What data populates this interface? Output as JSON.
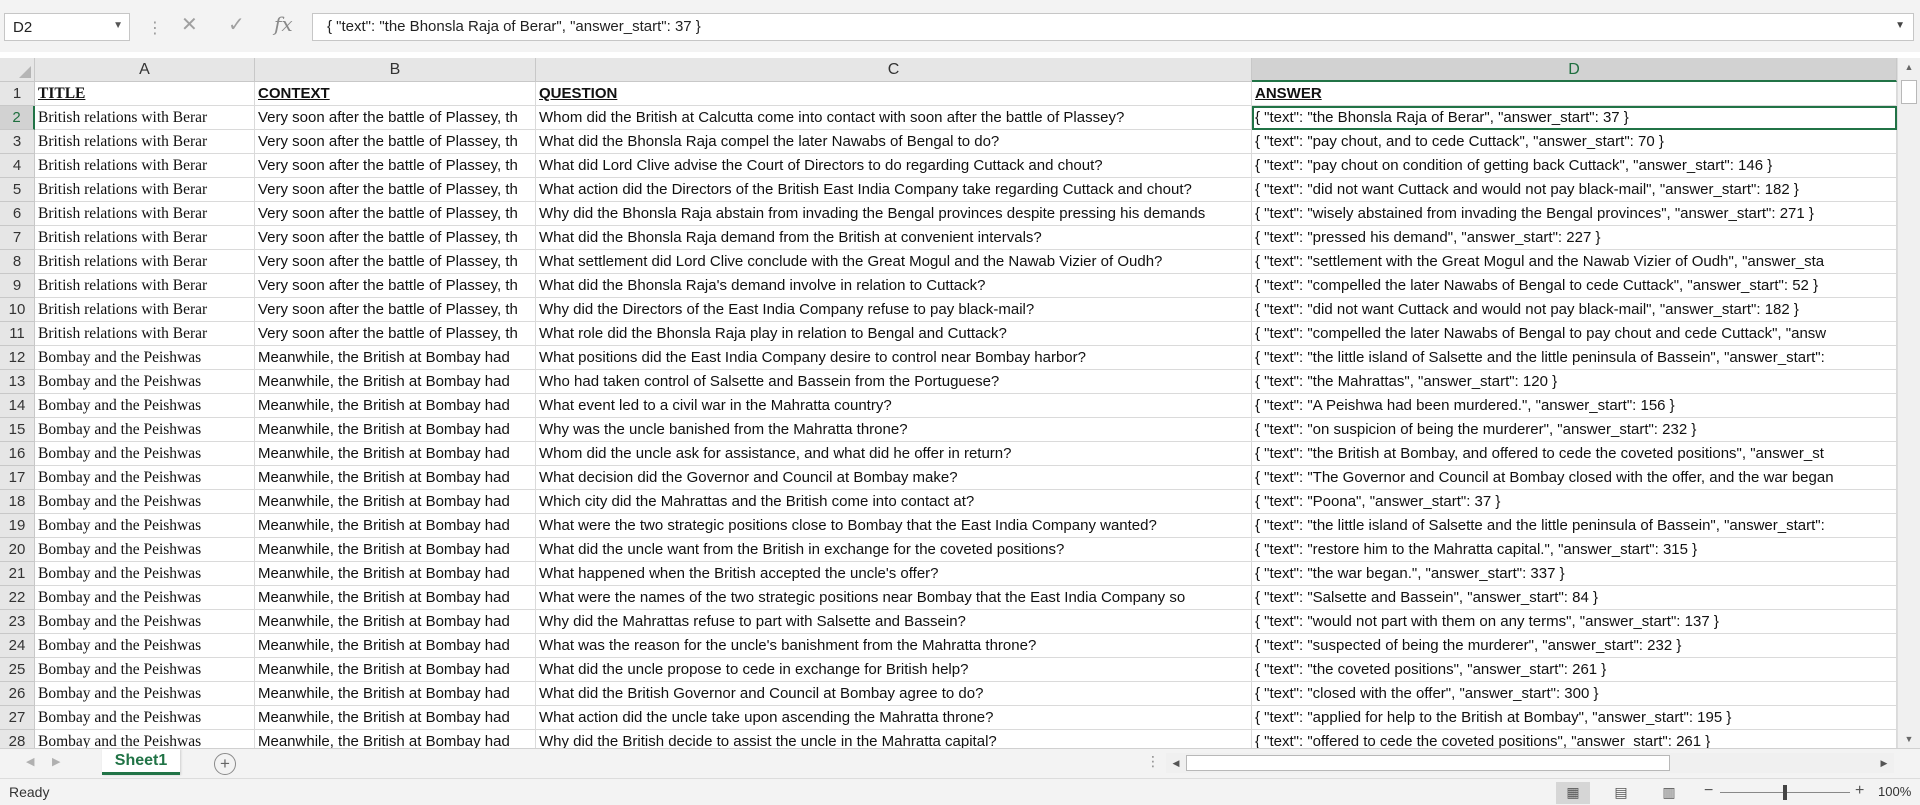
{
  "formula_bar": {
    "cell_ref": "D2",
    "formula": "{ \"text\": \"the Bhonsla Raja of Berar\", \"answer_start\": 37 }",
    "cancel_icon": "close-icon",
    "enter_icon": "check-icon",
    "function_label": "fx"
  },
  "columns": [
    "A",
    "B",
    "C",
    "D"
  ],
  "rows": [
    {
      "n": "1",
      "cells": [
        "TITLE",
        "CONTEXT",
        "QUESTION",
        "ANSWER"
      ]
    },
    {
      "n": "2",
      "cells": [
        "British relations with Berar",
        "Very soon after the battle of Plassey, th",
        "Whom did the British at Calcutta come into contact with soon after the battle of Plassey?",
        "{ \"text\": \"the Bhonsla Raja of Berar\", \"answer_start\": 37 }"
      ]
    },
    {
      "n": "3",
      "cells": [
        "British relations with Berar",
        "Very soon after the battle of Plassey, th",
        "What did the Bhonsla Raja compel the later Nawabs of Bengal to do?",
        "{ \"text\": \"pay chout, and to cede Cuttack\", \"answer_start\": 70 }"
      ]
    },
    {
      "n": "4",
      "cells": [
        "British relations with Berar",
        "Very soon after the battle of Plassey, th",
        "What did Lord Clive advise the Court of Directors to do regarding Cuttack and chout?",
        "{ \"text\": \"pay chout on condition of getting back Cuttack\", \"answer_start\": 146 }"
      ]
    },
    {
      "n": "5",
      "cells": [
        "British relations with Berar",
        "Very soon after the battle of Plassey, th",
        "What action did the Directors of the British East India Company take regarding Cuttack and chout?",
        "{ \"text\": \"did not want Cuttack and would not pay black-mail\", \"answer_start\": 182 }"
      ]
    },
    {
      "n": "6",
      "cells": [
        "British relations with Berar",
        "Very soon after the battle of Plassey, th",
        "Why did the Bhonsla Raja abstain from invading the Bengal provinces despite pressing his demands",
        "{ \"text\": \"wisely abstained from invading the Bengal provinces\", \"answer_start\": 271 }"
      ]
    },
    {
      "n": "7",
      "cells": [
        "British relations with Berar",
        "Very soon after the battle of Plassey, th",
        "What did the Bhonsla Raja demand from the British at convenient intervals?",
        "{ \"text\": \"pressed his demand\", \"answer_start\": 227 }"
      ]
    },
    {
      "n": "8",
      "cells": [
        "British relations with Berar",
        "Very soon after the battle of Plassey, th",
        "What settlement did Lord Clive conclude with the Great Mogul and the Nawab Vizier of Oudh?",
        "{ \"text\": \"settlement with the Great Mogul and the Nawab Vizier of Oudh\", \"answer_sta"
      ]
    },
    {
      "n": "9",
      "cells": [
        "British relations with Berar",
        "Very soon after the battle of Plassey, th",
        "What did the Bhonsla Raja's demand involve in relation to Cuttack?",
        "{ \"text\": \"compelled the later Nawabs of Bengal to cede Cuttack\", \"answer_start\": 52 }"
      ]
    },
    {
      "n": "10",
      "cells": [
        "British relations with Berar",
        "Very soon after the battle of Plassey, th",
        "Why did the Directors of the East India Company refuse to pay black-mail?",
        "{ \"text\": \"did not want Cuttack and would not pay black-mail\", \"answer_start\": 182 }"
      ]
    },
    {
      "n": "11",
      "cells": [
        "British relations with Berar",
        "Very soon after the battle of Plassey, th",
        "What role did the Bhonsla Raja play in relation to Bengal and Cuttack?",
        "{ \"text\": \"compelled the later Nawabs of Bengal to pay chout and cede Cuttack\", \"answ"
      ]
    },
    {
      "n": "12",
      "cells": [
        "Bombay and the Peishwas",
        "Meanwhile, the British at Bombay had",
        "What positions did the East India Company desire to control near Bombay harbor?",
        "{ \"text\": \"the little island of Salsette and the little peninsula of Bassein\", \"answer_start\":"
      ]
    },
    {
      "n": "13",
      "cells": [
        "Bombay and the Peishwas",
        "Meanwhile, the British at Bombay had",
        "Who had taken control of Salsette and Bassein from the Portuguese?",
        "{ \"text\": \"the Mahrattas\", \"answer_start\": 120 }"
      ]
    },
    {
      "n": "14",
      "cells": [
        "Bombay and the Peishwas",
        "Meanwhile, the British at Bombay had",
        "What event led to a civil war in the Mahratta country?",
        "{ \"text\": \"A Peishwa had been murdered.\", \"answer_start\": 156 }"
      ]
    },
    {
      "n": "15",
      "cells": [
        "Bombay and the Peishwas",
        "Meanwhile, the British at Bombay had",
        "Why was the uncle banished from the Mahratta throne?",
        "{ \"text\": \"on suspicion of being the murderer\", \"answer_start\": 232 }"
      ]
    },
    {
      "n": "16",
      "cells": [
        "Bombay and the Peishwas",
        "Meanwhile, the British at Bombay had",
        "Whom did the uncle ask for assistance, and what did he offer in return?",
        "{ \"text\": \"the British at Bombay, and offered to cede the coveted positions\", \"answer_st"
      ]
    },
    {
      "n": "17",
      "cells": [
        "Bombay and the Peishwas",
        "Meanwhile, the British at Bombay had",
        "What decision did the Governor and Council at Bombay make?",
        "{ \"text\": \"The Governor and Council at Bombay closed with the offer, and the war began"
      ]
    },
    {
      "n": "18",
      "cells": [
        "Bombay and the Peishwas",
        "Meanwhile, the British at Bombay had",
        "Which city did the Mahrattas and the British come into contact at?",
        "{ \"text\": \"Poona\", \"answer_start\": 37 }"
      ]
    },
    {
      "n": "19",
      "cells": [
        "Bombay and the Peishwas",
        "Meanwhile, the British at Bombay had",
        "What were the two strategic positions close to Bombay that the East India Company wanted?",
        "{ \"text\": \"the little island of Salsette and the little peninsula of Bassein\", \"answer_start\":"
      ]
    },
    {
      "n": "20",
      "cells": [
        "Bombay and the Peishwas",
        "Meanwhile, the British at Bombay had",
        "What did the uncle want from the British in exchange for the coveted positions?",
        "{ \"text\": \"restore him to the Mahratta capital.\", \"answer_start\": 315 }"
      ]
    },
    {
      "n": "21",
      "cells": [
        "Bombay and the Peishwas",
        "Meanwhile, the British at Bombay had",
        "What happened when the British accepted the uncle's offer?",
        "{ \"text\": \"the war began.\", \"answer_start\": 337 }"
      ]
    },
    {
      "n": "22",
      "cells": [
        "Bombay and the Peishwas",
        "Meanwhile, the British at Bombay had",
        "What were the names of the two strategic positions near Bombay that the East India Company so",
        "{ \"text\": \"Salsette and Bassein\", \"answer_start\": 84 }"
      ]
    },
    {
      "n": "23",
      "cells": [
        "Bombay and the Peishwas",
        "Meanwhile, the British at Bombay had",
        "Why did the Mahrattas refuse to part with Salsette and Bassein?",
        "{ \"text\": \"would not part with them on any terms\", \"answer_start\": 137 }"
      ]
    },
    {
      "n": "24",
      "cells": [
        "Bombay and the Peishwas",
        "Meanwhile, the British at Bombay had",
        "What was the reason for the uncle's banishment from the Mahratta throne?",
        "{ \"text\": \"suspected of being the murderer\", \"answer_start\": 232 }"
      ]
    },
    {
      "n": "25",
      "cells": [
        "Bombay and the Peishwas",
        "Meanwhile, the British at Bombay had",
        "What did the uncle propose to cede in exchange for British help?",
        "{ \"text\": \"the coveted positions\", \"answer_start\": 261 }"
      ]
    },
    {
      "n": "26",
      "cells": [
        "Bombay and the Peishwas",
        "Meanwhile, the British at Bombay had",
        "What did the British Governor and Council at Bombay agree to do?",
        "{ \"text\": \"closed with the offer\", \"answer_start\": 300 }"
      ]
    },
    {
      "n": "27",
      "cells": [
        "Bombay and the Peishwas",
        "Meanwhile, the British at Bombay had",
        "What action did the uncle take upon ascending the Mahratta throne?",
        "{ \"text\": \"applied for help to the British at Bombay\", \"answer_start\": 195 }"
      ]
    },
    {
      "n": "28",
      "cells": [
        "Bombay and the Peishwas",
        "Meanwhile, the British at Bombay had",
        "Why did the British decide to assist the uncle in the Mahratta capital?",
        "{ \"text\": \"offered to cede the coveted positions\", \"answer_start\": 261 }"
      ]
    }
  ],
  "active_cell": {
    "row": "2",
    "col": "D"
  },
  "sheet_tabs": [
    {
      "label": "Sheet1",
      "active": true
    }
  ],
  "status": {
    "text": "Ready",
    "zoom_label": "100%",
    "zoom_level_percent": 100,
    "views": [
      "normal-view-icon",
      "page-layout-icon",
      "page-break-preview-icon"
    ]
  },
  "colors": {
    "accent": "#217346",
    "header_bg": "#e6e6e6",
    "gridline": "#dadada"
  }
}
